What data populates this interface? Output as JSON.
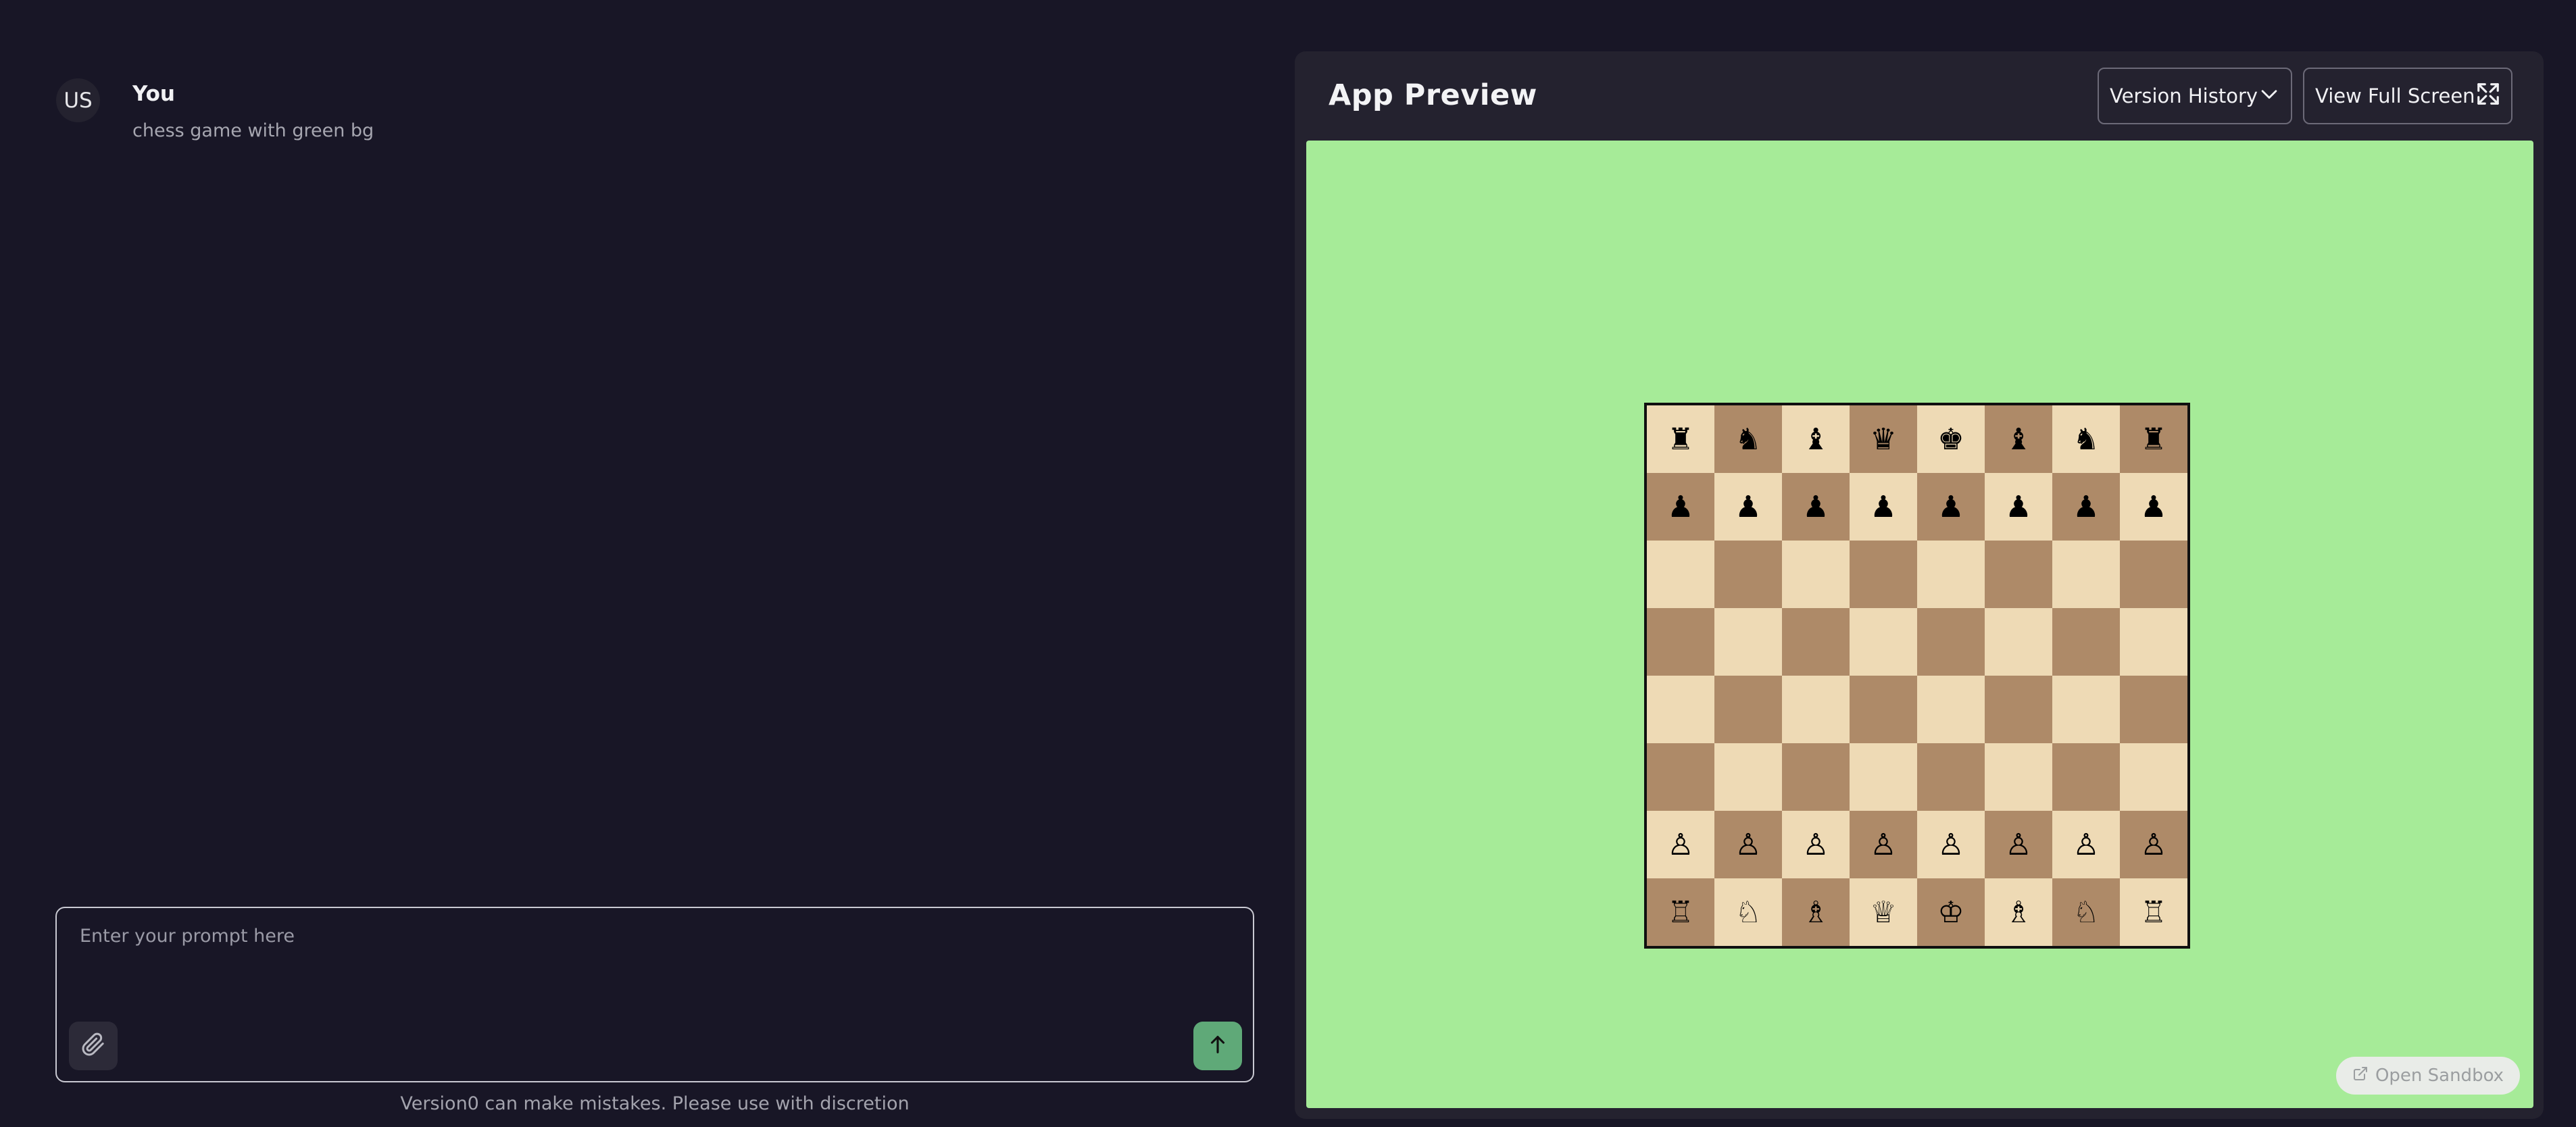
{
  "chat": {
    "messages": [
      {
        "avatar": "US",
        "sender": "You",
        "text": "chess game with green bg"
      }
    ],
    "prompt": {
      "placeholder": "Enter your prompt here",
      "value": ""
    },
    "attach_icon": "paperclip-icon",
    "send_icon": "arrow-up-icon",
    "disclaimer": "Version0 can make mistakes. Please use with discretion"
  },
  "preview": {
    "title": "App Preview",
    "version_history_label": "Version History",
    "version_history_icon": "chevron-down-icon",
    "full_screen_label": "View Full Screen",
    "full_screen_icon": "expand-icon",
    "open_sandbox_label": "Open Sandbox",
    "open_sandbox_icon": "external-link-icon",
    "background_color": "#a6eb98"
  },
  "chess": {
    "light_color": "#eedab5",
    "dark_color": "#ae8a68",
    "rows": [
      [
        "♜",
        "♞",
        "♝",
        "♛",
        "♚",
        "♝",
        "♞",
        "♜"
      ],
      [
        "♟",
        "♟",
        "♟",
        "♟",
        "♟",
        "♟",
        "♟",
        "♟"
      ],
      [
        "",
        "",
        "",
        "",
        "",
        "",
        "",
        ""
      ],
      [
        "",
        "",
        "",
        "",
        "",
        "",
        "",
        ""
      ],
      [
        "",
        "",
        "",
        "",
        "",
        "",
        "",
        ""
      ],
      [
        "",
        "",
        "",
        "",
        "",
        "",
        "",
        ""
      ],
      [
        "♙",
        "♙",
        "♙",
        "♙",
        "♙",
        "♙",
        "♙",
        "♙"
      ],
      [
        "♖",
        "♘",
        "♗",
        "♕",
        "♔",
        "♗",
        "♘",
        "♖"
      ]
    ]
  }
}
